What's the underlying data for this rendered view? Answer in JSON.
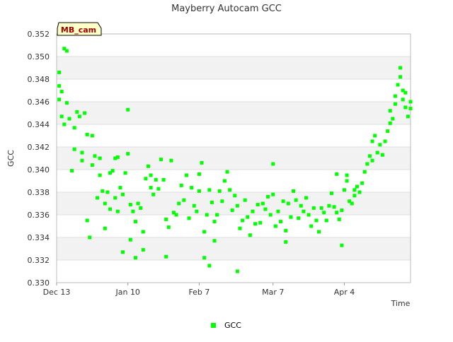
{
  "chart_data": {
    "type": "scatter",
    "title": "Mayberry Autocam GCC",
    "xlabel": "Time",
    "ylabel": "GCC",
    "badge": "MB_cam",
    "ylim": [
      0.33,
      0.352
    ],
    "yticks": [
      "0.330",
      "0.332",
      "0.334",
      "0.336",
      "0.338",
      "0.340",
      "0.342",
      "0.344",
      "0.346",
      "0.348",
      "0.350",
      "0.352"
    ],
    "xlim": [
      "2023-12-13",
      "2024-04-30"
    ],
    "xticks": [
      {
        "date": "2023-12-13",
        "label": "Dec 13"
      },
      {
        "date": "2024-01-10",
        "label": "Jan 10"
      },
      {
        "date": "2024-02-07",
        "label": "Feb 7"
      },
      {
        "date": "2024-03-07",
        "label": "Mar 7"
      },
      {
        "date": "2024-04-04",
        "label": "Apr 4"
      }
    ],
    "grid": "horizontal alternating bands",
    "legend_position": "bottom",
    "series": [
      {
        "name": "GCC",
        "color": "#00ff00",
        "points": [
          [
            "2023-12-14",
            0.3486
          ],
          [
            "2023-12-14",
            0.3474
          ],
          [
            "2023-12-14",
            0.3462
          ],
          [
            "2023-12-15",
            0.3469
          ],
          [
            "2023-12-15",
            0.3447
          ],
          [
            "2023-12-16",
            0.344
          ],
          [
            "2023-12-16",
            0.3507
          ],
          [
            "2023-12-17",
            0.3505
          ],
          [
            "2023-12-17",
            0.3459
          ],
          [
            "2023-12-18",
            0.3445
          ],
          [
            "2023-12-19",
            0.3399
          ],
          [
            "2023-12-20",
            0.3437
          ],
          [
            "2023-12-20",
            0.3418
          ],
          [
            "2023-12-21",
            0.3451
          ],
          [
            "2023-12-22",
            0.3447
          ],
          [
            "2023-12-23",
            0.3415
          ],
          [
            "2023-12-23",
            0.3408
          ],
          [
            "2023-12-24",
            0.345
          ],
          [
            "2023-12-25",
            0.3431
          ],
          [
            "2023-12-25",
            0.3355
          ],
          [
            "2023-12-26",
            0.334
          ],
          [
            "2023-12-27",
            0.3404
          ],
          [
            "2023-12-27",
            0.343
          ],
          [
            "2023-12-28",
            0.3412
          ],
          [
            "2023-12-29",
            0.3375
          ],
          [
            "2023-12-30",
            0.341
          ],
          [
            "2023-12-30",
            0.3395
          ],
          [
            "2023-12-31",
            0.3381
          ],
          [
            "2024-01-01",
            0.3348
          ],
          [
            "2024-01-01",
            0.337
          ],
          [
            "2024-01-02",
            0.338
          ],
          [
            "2024-01-03",
            0.3397
          ],
          [
            "2024-01-03",
            0.3365
          ],
          [
            "2024-01-04",
            0.3399
          ],
          [
            "2024-01-05",
            0.3375
          ],
          [
            "2024-01-05",
            0.341
          ],
          [
            "2024-01-06",
            0.3363
          ],
          [
            "2024-01-06",
            0.3411
          ],
          [
            "2024-01-07",
            0.3384
          ],
          [
            "2024-01-08",
            0.3327
          ],
          [
            "2024-01-08",
            0.3378
          ],
          [
            "2024-01-09",
            0.3397
          ],
          [
            "2024-01-10",
            0.3453
          ],
          [
            "2024-01-10",
            0.3414
          ],
          [
            "2024-01-11",
            0.3369
          ],
          [
            "2024-01-11",
            0.3338
          ],
          [
            "2024-01-12",
            0.3363
          ],
          [
            "2024-01-13",
            0.3322
          ],
          [
            "2024-01-13",
            0.3354
          ],
          [
            "2024-01-14",
            0.337
          ],
          [
            "2024-01-15",
            0.3366
          ],
          [
            "2024-01-16",
            0.3329
          ],
          [
            "2024-01-16",
            0.3345
          ],
          [
            "2024-01-17",
            0.3392
          ],
          [
            "2024-01-18",
            0.3403
          ],
          [
            "2024-01-19",
            0.3384
          ],
          [
            "2024-01-19",
            0.3395
          ],
          [
            "2024-01-20",
            0.3378
          ],
          [
            "2024-01-21",
            0.3391
          ],
          [
            "2024-01-22",
            0.3383
          ],
          [
            "2024-01-23",
            0.3409
          ],
          [
            "2024-01-24",
            0.3391
          ],
          [
            "2024-01-25",
            0.3356
          ],
          [
            "2024-01-25",
            0.3323
          ],
          [
            "2024-01-26",
            0.3349
          ],
          [
            "2024-01-27",
            0.3408
          ],
          [
            "2024-01-28",
            0.3362
          ],
          [
            "2024-01-29",
            0.336
          ],
          [
            "2024-01-30",
            0.337
          ],
          [
            "2024-01-31",
            0.3386
          ],
          [
            "2024-02-01",
            0.3373
          ],
          [
            "2024-02-02",
            0.3395
          ],
          [
            "2024-02-03",
            0.3357
          ],
          [
            "2024-02-04",
            0.3384
          ],
          [
            "2024-02-05",
            0.3368
          ],
          [
            "2024-02-06",
            0.3363
          ],
          [
            "2024-02-07",
            0.3381
          ],
          [
            "2024-02-07",
            0.3396
          ],
          [
            "2024-02-08",
            0.3406
          ],
          [
            "2024-02-09",
            0.3345
          ],
          [
            "2024-02-09",
            0.3322
          ],
          [
            "2024-02-10",
            0.336
          ],
          [
            "2024-02-11",
            0.3382
          ],
          [
            "2024-02-11",
            0.3315
          ],
          [
            "2024-02-12",
            0.3371
          ],
          [
            "2024-02-13",
            0.3354
          ],
          [
            "2024-02-13",
            0.3337
          ],
          [
            "2024-02-14",
            0.336
          ],
          [
            "2024-02-15",
            0.3381
          ],
          [
            "2024-02-16",
            0.3372
          ],
          [
            "2024-02-17",
            0.339
          ],
          [
            "2024-02-18",
            0.3398
          ],
          [
            "2024-02-19",
            0.3382
          ],
          [
            "2024-02-20",
            0.3364
          ],
          [
            "2024-02-21",
            0.3377
          ],
          [
            "2024-02-22",
            0.331
          ],
          [
            "2024-02-22",
            0.3368
          ],
          [
            "2024-02-23",
            0.3348
          ],
          [
            "2024-02-24",
            0.3355
          ],
          [
            "2024-02-25",
            0.3373
          ],
          [
            "2024-02-26",
            0.3358
          ],
          [
            "2024-02-27",
            0.3342
          ],
          [
            "2024-02-28",
            0.3363
          ],
          [
            "2024-02-29",
            0.3352
          ],
          [
            "2024-03-01",
            0.3369
          ],
          [
            "2024-03-02",
            0.3353
          ],
          [
            "2024-03-03",
            0.337
          ],
          [
            "2024-03-04",
            0.3365
          ],
          [
            "2024-03-05",
            0.3376
          ],
          [
            "2024-03-06",
            0.336
          ],
          [
            "2024-03-07",
            0.3405
          ],
          [
            "2024-03-07",
            0.3378
          ],
          [
            "2024-03-08",
            0.335
          ],
          [
            "2024-03-09",
            0.3363
          ],
          [
            "2024-03-10",
            0.3354
          ],
          [
            "2024-03-11",
            0.3372
          ],
          [
            "2024-03-12",
            0.3346
          ],
          [
            "2024-03-12",
            0.3336
          ],
          [
            "2024-03-13",
            0.337
          ],
          [
            "2024-03-14",
            0.3358
          ],
          [
            "2024-03-15",
            0.3381
          ],
          [
            "2024-03-16",
            0.3373
          ],
          [
            "2024-03-17",
            0.3357
          ],
          [
            "2024-03-18",
            0.3368
          ],
          [
            "2024-03-19",
            0.3363
          ],
          [
            "2024-03-20",
            0.3375
          ],
          [
            "2024-03-21",
            0.336
          ],
          [
            "2024-03-22",
            0.335
          ],
          [
            "2024-03-23",
            0.3366
          ],
          [
            "2024-03-24",
            0.3355
          ],
          [
            "2024-03-25",
            0.3345
          ],
          [
            "2024-03-26",
            0.3366
          ],
          [
            "2024-03-27",
            0.3362
          ],
          [
            "2024-03-28",
            0.3355
          ],
          [
            "2024-03-29",
            0.3368
          ],
          [
            "2024-03-30",
            0.3379
          ],
          [
            "2024-03-31",
            0.3367
          ],
          [
            "2024-04-01",
            0.3396
          ],
          [
            "2024-04-01",
            0.3362
          ],
          [
            "2024-04-02",
            0.3356
          ],
          [
            "2024-04-03",
            0.3333
          ],
          [
            "2024-04-03",
            0.3364
          ],
          [
            "2024-04-04",
            0.3382
          ],
          [
            "2024-04-05",
            0.339
          ],
          [
            "2024-04-05",
            0.3395
          ],
          [
            "2024-04-06",
            0.3372
          ],
          [
            "2024-04-07",
            0.337
          ],
          [
            "2024-04-08",
            0.3382
          ],
          [
            "2024-04-08",
            0.3377
          ],
          [
            "2024-04-09",
            0.3385
          ],
          [
            "2024-04-10",
            0.338
          ],
          [
            "2024-04-11",
            0.3388
          ],
          [
            "2024-04-12",
            0.3398
          ],
          [
            "2024-04-13",
            0.3405
          ],
          [
            "2024-04-14",
            0.3412
          ],
          [
            "2024-04-15",
            0.3408
          ],
          [
            "2024-04-15",
            0.3425
          ],
          [
            "2024-04-16",
            0.343
          ],
          [
            "2024-04-17",
            0.3415
          ],
          [
            "2024-04-18",
            0.3422
          ],
          [
            "2024-04-19",
            0.3413
          ],
          [
            "2024-04-20",
            0.3425
          ],
          [
            "2024-04-21",
            0.3434
          ],
          [
            "2024-04-22",
            0.3441
          ],
          [
            "2024-04-22",
            0.3452
          ],
          [
            "2024-04-23",
            0.3445
          ],
          [
            "2024-04-24",
            0.3465
          ],
          [
            "2024-04-24",
            0.3458
          ],
          [
            "2024-04-25",
            0.3475
          ],
          [
            "2024-04-26",
            0.3482
          ],
          [
            "2024-04-26",
            0.349
          ],
          [
            "2024-04-27",
            0.347
          ],
          [
            "2024-04-27",
            0.3462
          ],
          [
            "2024-04-28",
            0.3468
          ],
          [
            "2024-04-28",
            0.3455
          ],
          [
            "2024-04-29",
            0.3447
          ],
          [
            "2024-04-30",
            0.346
          ],
          [
            "2024-04-30",
            0.3454
          ]
        ]
      }
    ]
  }
}
